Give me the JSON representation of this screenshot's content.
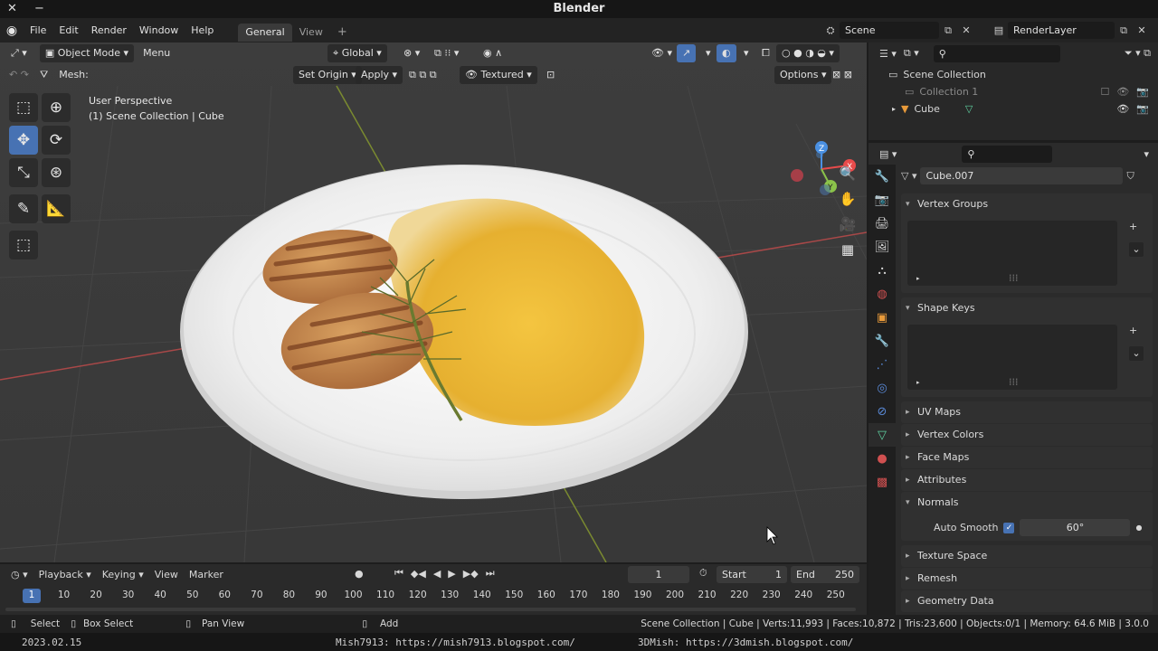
{
  "title_bar": {
    "title": "Blender"
  },
  "top_menu": {
    "items": [
      "File",
      "Edit",
      "Render",
      "Window",
      "Help"
    ],
    "workspaces": [
      {
        "label": "General"
      },
      {
        "label": "View"
      }
    ],
    "add_tab": "+",
    "scene": "Scene",
    "render_layer": "RenderLayer"
  },
  "viewport_header": {
    "mode": "Object Mode",
    "menu": "Menu",
    "orientation": "Global",
    "mesh_label": "Mesh:",
    "set_origin": "Set Origin",
    "apply": "Apply",
    "shading": "Textured",
    "options": "Options"
  },
  "viewport": {
    "perspective": "User Perspective",
    "collection_info": "(1) Scene Collection | Cube",
    "gizmo": {
      "x": "X",
      "y": "Y",
      "z": "Z"
    }
  },
  "outliner": {
    "root": "Scene Collection",
    "items": [
      {
        "label": "Collection 1"
      },
      {
        "label": "Cube"
      }
    ]
  },
  "properties": {
    "mesh_name": "Cube.007",
    "panels": {
      "vertex_groups": "Vertex Groups",
      "shape_keys": "Shape Keys",
      "uv_maps": "UV Maps",
      "vertex_colors": "Vertex Colors",
      "face_maps": "Face Maps",
      "attributes": "Attributes",
      "normals": "Normals",
      "auto_smooth": "Auto Smooth",
      "auto_smooth_angle": "60°",
      "texture_space": "Texture Space",
      "remesh": "Remesh",
      "geometry_data": "Geometry Data"
    }
  },
  "timeline": {
    "playback": "Playback",
    "keying": "Keying",
    "view": "View",
    "marker": "Marker",
    "current_frame": "1",
    "start_label": "Start",
    "start": "1",
    "end_label": "End",
    "end": "250",
    "ticks": [
      "1",
      "10",
      "20",
      "30",
      "40",
      "50",
      "60",
      "70",
      "80",
      "90",
      "100",
      "110",
      "120",
      "130",
      "140",
      "150",
      "160",
      "170",
      "180",
      "190",
      "200",
      "210",
      "220",
      "230",
      "240",
      "250"
    ]
  },
  "status_bar": {
    "select": "Select",
    "box_select": "Box Select",
    "pan_view": "Pan View",
    "add": "Add",
    "stats": "Scene Collection | Cube | Verts:11,993 | Faces:10,872 | Tris:23,600 | Objects:0/1 | Memory: 64.6 MiB | 3.0.0"
  },
  "overlay_text": {
    "date": "2023.02.15",
    "blog1": "Mish7913: https://mish7913.blogspot.com/",
    "blog2": "3DMish: https://3dmish.blogspot.com/"
  },
  "colors": {
    "accent": "#4772b3",
    "plate": "#f2f2f2",
    "mash": "#e8b838",
    "cutlet": "#c08048",
    "x_axis": "#e84b4b",
    "y_axis": "#8bc34a",
    "z_axis": "#4a90e2"
  }
}
